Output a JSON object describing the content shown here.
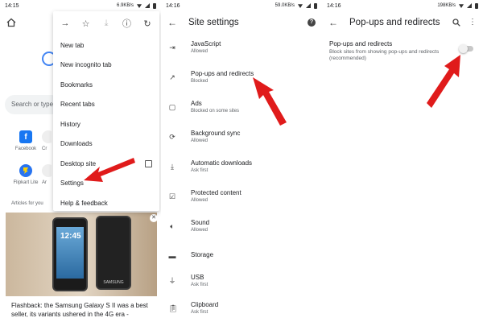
{
  "panel1": {
    "status": {
      "time": "14:15",
      "net": "6.9KB/s"
    },
    "search_placeholder": "Search or type",
    "tiles": [
      {
        "label": "Facebook",
        "letter": "f"
      },
      {
        "label": "Cr"
      },
      {
        "label": "Flipkart Lite"
      },
      {
        "label": "Ar"
      }
    ],
    "articles_label": "Articles for you",
    "article_text": "Flashback: the Samsung Galaxy S II was a best seller, its variants ushered in the 4G era -",
    "phone_clock": "12:45",
    "phone_brand": "SAMSUNG",
    "menu": {
      "icons": [
        "forward-icon",
        "star-icon",
        "download-icon",
        "info-icon",
        "refresh-icon"
      ],
      "items": [
        "New tab",
        "New incognito tab",
        "Bookmarks",
        "Recent tabs",
        "History",
        "Downloads",
        "Desktop site",
        "Settings",
        "Help & feedback"
      ]
    }
  },
  "panel2": {
    "status": {
      "time": "14:16",
      "net": "59.0KB/s"
    },
    "title": "Site settings",
    "items": [
      {
        "title": "JavaScript",
        "sub": "Allowed"
      },
      {
        "title": "Pop-ups and redirects",
        "sub": "Blocked"
      },
      {
        "title": "Ads",
        "sub": "Blocked on some sites"
      },
      {
        "title": "Background sync",
        "sub": "Allowed"
      },
      {
        "title": "Automatic downloads",
        "sub": "Ask first"
      },
      {
        "title": "Protected content",
        "sub": "Allowed"
      },
      {
        "title": "Sound",
        "sub": "Allowed"
      },
      {
        "title": "Storage",
        "sub": ""
      },
      {
        "title": "USB",
        "sub": "Ask first"
      },
      {
        "title": "Clipboard",
        "sub": "Ask first"
      }
    ]
  },
  "panel3": {
    "status": {
      "time": "14:16",
      "net": "198KB/s"
    },
    "title": "Pop-ups and redirects",
    "setting_title": "Pop-ups and redirects",
    "setting_desc": "Block sites from showing pop-ups and redirects (recommended)",
    "toggle_on": false
  },
  "colors": {
    "arrow": "#e01b1b",
    "accent": "#4285f4"
  }
}
